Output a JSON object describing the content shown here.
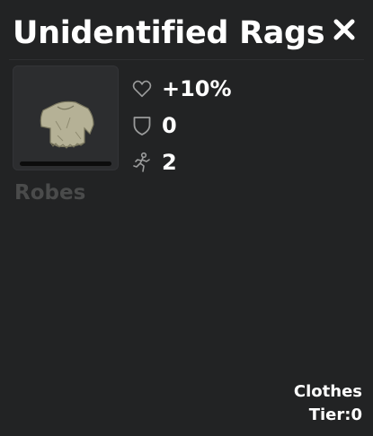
{
  "item": {
    "name": "Unidentified Rags",
    "category": "Robes",
    "icon": "rags-shirt-icon",
    "item_color": "#b5b196"
  },
  "stats": [
    {
      "icon": "heart-outline-icon",
      "value": "+10%"
    },
    {
      "icon": "shield-outline-icon",
      "value": "0"
    },
    {
      "icon": "running-figure-icon",
      "value": "2"
    }
  ],
  "footer": {
    "type": "Clothes",
    "tier": "Tier:0"
  },
  "colors": {
    "background": "#222324",
    "slot_background": "#2c2d2f",
    "category_text": "#4a4b4b",
    "stat_icon": "#9a9b9b",
    "text": "#ffffff"
  }
}
